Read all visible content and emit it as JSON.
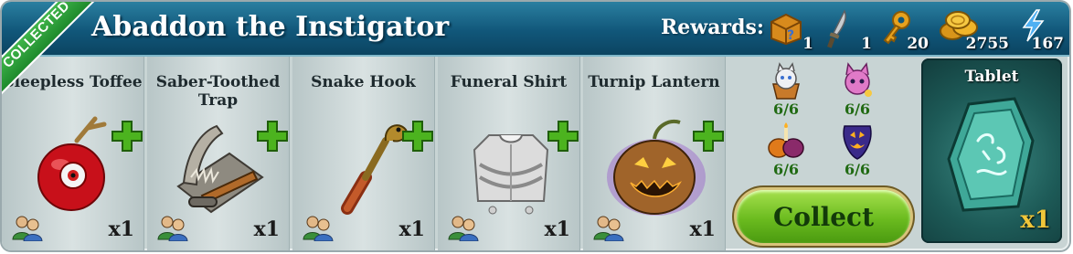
{
  "header": {
    "title": "Abaddon the Instigator",
    "status_ribbon": "COLLECTED",
    "rewards_label": "Rewards:"
  },
  "rewards": [
    {
      "icon": "mystery-chest-icon",
      "count": "1"
    },
    {
      "icon": "dagger-icon",
      "count": "1"
    },
    {
      "icon": "golden-key-icon",
      "count": "20"
    },
    {
      "icon": "gold-coins-icon",
      "count": "2755"
    },
    {
      "icon": "energy-lightning-icon",
      "count": "167"
    }
  ],
  "items": [
    {
      "name": "Sleepless Toffee",
      "qty": "x1",
      "icon": "candy-apple-icon"
    },
    {
      "name": "Saber-Toothed Trap",
      "qty": "x1",
      "icon": "bear-trap-icon"
    },
    {
      "name": "Snake Hook",
      "qty": "x1",
      "icon": "snake-hook-icon"
    },
    {
      "name": "Funeral Shirt",
      "qty": "x1",
      "icon": "straitjacket-icon"
    },
    {
      "name": "Turnip Lantern",
      "qty": "x1",
      "icon": "jack-o-lantern-icon"
    }
  ],
  "ingredients": [
    {
      "icon": "cat-cupcake-icon",
      "progress": "6/6"
    },
    {
      "icon": "pink-cat-icon",
      "progress": "6/6"
    },
    {
      "icon": "candle-pumpkins-icon",
      "progress": "6/6"
    },
    {
      "icon": "pumpkin-pick-icon",
      "progress": "6/6"
    }
  ],
  "collect_button": "Collect",
  "result": {
    "name": "Tablet",
    "qty": "x1",
    "icon": "rune-tablet-icon"
  },
  "colors": {
    "header": "#11577a",
    "button_green": "#6bbb1f",
    "ribbon_green": "#2a9e38",
    "progress_green": "#206a12",
    "result_qty_gold": "#f0c63a"
  }
}
